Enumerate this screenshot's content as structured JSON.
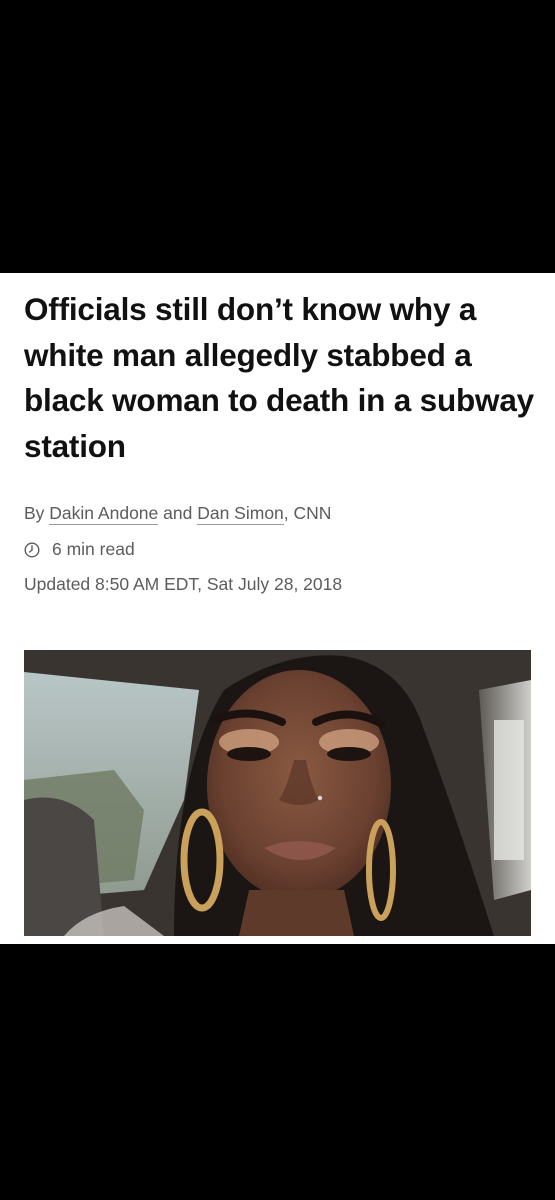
{
  "article": {
    "headline": "Officials still don’t know why a white man allegedly stabbed a black woman to death in a subway station",
    "byline": {
      "prefix": "By ",
      "author1": "Dakin Andone",
      "joiner": " and ",
      "author2": "Dan Simon",
      "suffix": ", CNN"
    },
    "read_time": "6 min read",
    "updated": "Updated 8:50 AM EDT, Sat July 28, 2018",
    "icons": {
      "read_time": "clock-icon"
    }
  },
  "colors": {
    "background": "#000000",
    "article_bg": "#ffffff",
    "headline": "#111111",
    "meta_text": "#5c5c5c"
  }
}
